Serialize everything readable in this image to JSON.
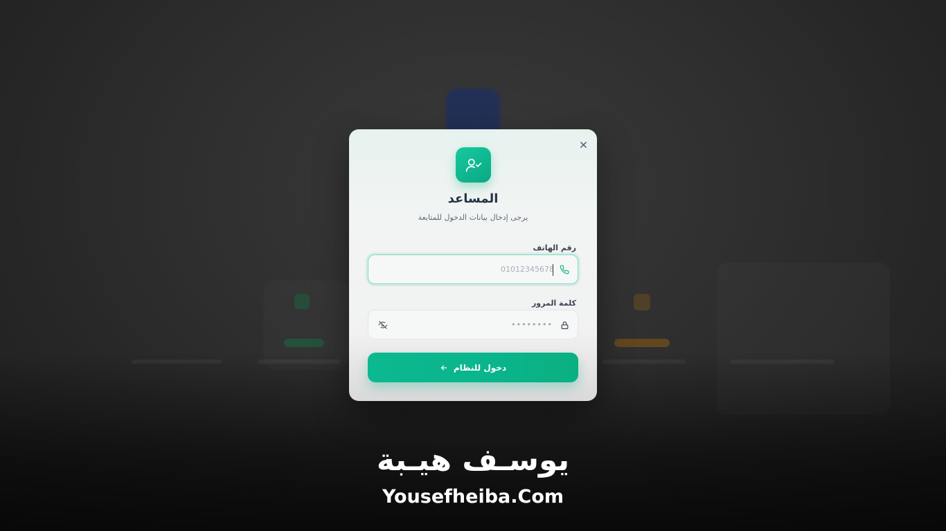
{
  "modal": {
    "title": "المساعد",
    "subtitle": "يرجى إدخال بيانات الدخول للمتابعة",
    "close_icon": "close-icon",
    "brand_icon": "user-check-icon",
    "accent_color": "#10b981"
  },
  "phone_field": {
    "label": "رقم الهاتف",
    "placeholder": "01012345678",
    "value": "",
    "icon": "phone-icon"
  },
  "password_field": {
    "label": "كلمة المرور",
    "masked_value": "••••••••",
    "icon": "lock-icon",
    "toggle_icon": "eye-off-icon"
  },
  "submit": {
    "label": "دخول للنظام",
    "icon": "arrow-left-icon"
  },
  "watermark": {
    "arabic": "يوسـف هيـبة",
    "latin": "Yousefheiba.Com"
  }
}
